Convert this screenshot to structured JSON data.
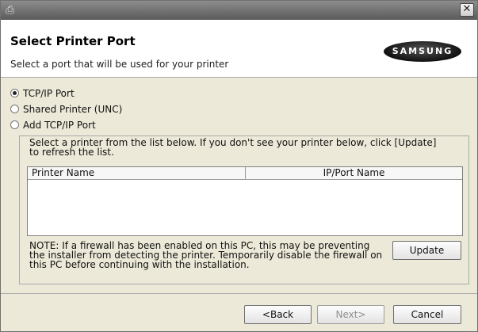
{
  "window": {
    "close_glyph": "✕",
    "app_icon": "printer-setup-icon"
  },
  "header": {
    "title": "Select Printer Port",
    "subtitle": "Select a port that will be used for your printer",
    "logo_text": "SAMSUNG"
  },
  "ports": [
    {
      "label": "TCP/IP Port",
      "selected": true
    },
    {
      "label": "Shared Printer (UNC)",
      "selected": false
    },
    {
      "label": "Add TCP/IP Port",
      "selected": false
    }
  ],
  "group": {
    "hint": "Select a printer from the list below. If you don't see your printer below, click [Update] to refresh the list.",
    "columns": [
      "Printer Name",
      "IP/Port Name"
    ],
    "note": "NOTE: If a firewall has been enabled on this PC, this may be preventing the installer from detecting the printer. Temporarily disable the firewall on this PC before continuing with the installation.",
    "update_label": "Update"
  },
  "footer": {
    "back_label": "<Back",
    "next_label": "Next>",
    "cancel_label": "Cancel"
  }
}
